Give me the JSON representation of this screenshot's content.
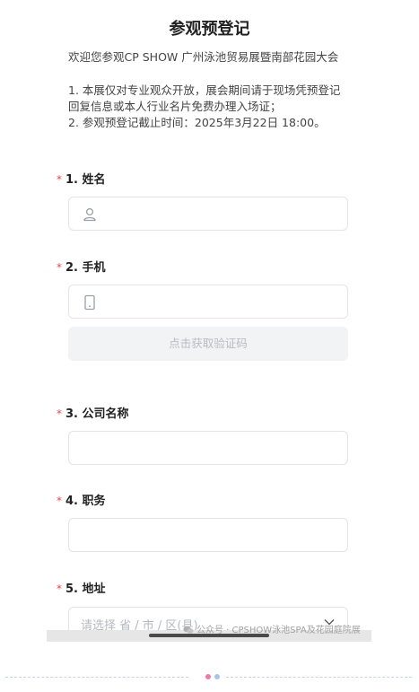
{
  "page": {
    "title": "参观预登记",
    "intro": "欢迎您参观CP SHOW 广州泳池贸易展暨南部花园大会",
    "notes": [
      "1. 本展仅对专业观众开放，展会期间请于现场凭预登记",
      "回复信息或本人行业名片免费办理入场证；",
      "2. 参观预登记截止时间：2025年3月22日 18:00。"
    ]
  },
  "form": {
    "required_mark": "*",
    "q1": {
      "label": "1. 姓名",
      "value": "",
      "icon": "person-icon"
    },
    "q2": {
      "label": "2. 手机",
      "value": "",
      "icon": "phone-icon",
      "code_button": "点击获取验证码"
    },
    "q3": {
      "label": "3. 公司名称",
      "value": ""
    },
    "q4": {
      "label": "4. 职务",
      "value": ""
    },
    "q5": {
      "label": "5. 地址",
      "placeholder": "请选择 省 / 市 / 区(县)",
      "icon": "chevron-down-icon"
    }
  },
  "watermark": {
    "text": "公众号 · CPSHOW泳池SPA及花园庭院展",
    "icon": "wechat-icon"
  },
  "colors": {
    "required": "#e5484d",
    "border": "#e2e4e8",
    "pager_active": "#f07ba0",
    "pager_inactive": "#a9c4ec"
  }
}
